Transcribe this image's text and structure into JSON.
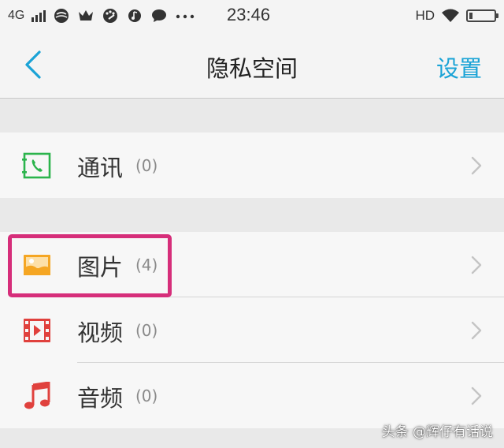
{
  "status_bar": {
    "network": "4G",
    "time": "23:46",
    "hd": "HD",
    "icons": [
      "signal-icon",
      "moon-icon",
      "crown-icon",
      "palette-icon",
      "music-icon",
      "chat-icon",
      "more-dots-icon",
      "wifi-icon",
      "battery-icon"
    ]
  },
  "nav": {
    "back_icon": "chevron-left-icon",
    "title": "隐私空间",
    "settings_label": "设置"
  },
  "list": {
    "contacts": {
      "label": "通讯",
      "count": "(0)",
      "icon": "phone-contact-icon"
    },
    "photos": {
      "label": "图片",
      "count": "(4)",
      "icon": "image-icon"
    },
    "videos": {
      "label": "视频",
      "count": "(0)",
      "icon": "video-icon"
    },
    "audio": {
      "label": "音频",
      "count": "(0)",
      "icon": "music-note-icon"
    }
  },
  "colors": {
    "accent": "#1aa3d6",
    "highlight": "#d62e7a",
    "contact_icon": "#2bb44c",
    "image_icon": "#f5a623",
    "video_icon": "#e0413d",
    "audio_icon": "#e0413d"
  },
  "watermark": "头条 @辉仔有话说"
}
